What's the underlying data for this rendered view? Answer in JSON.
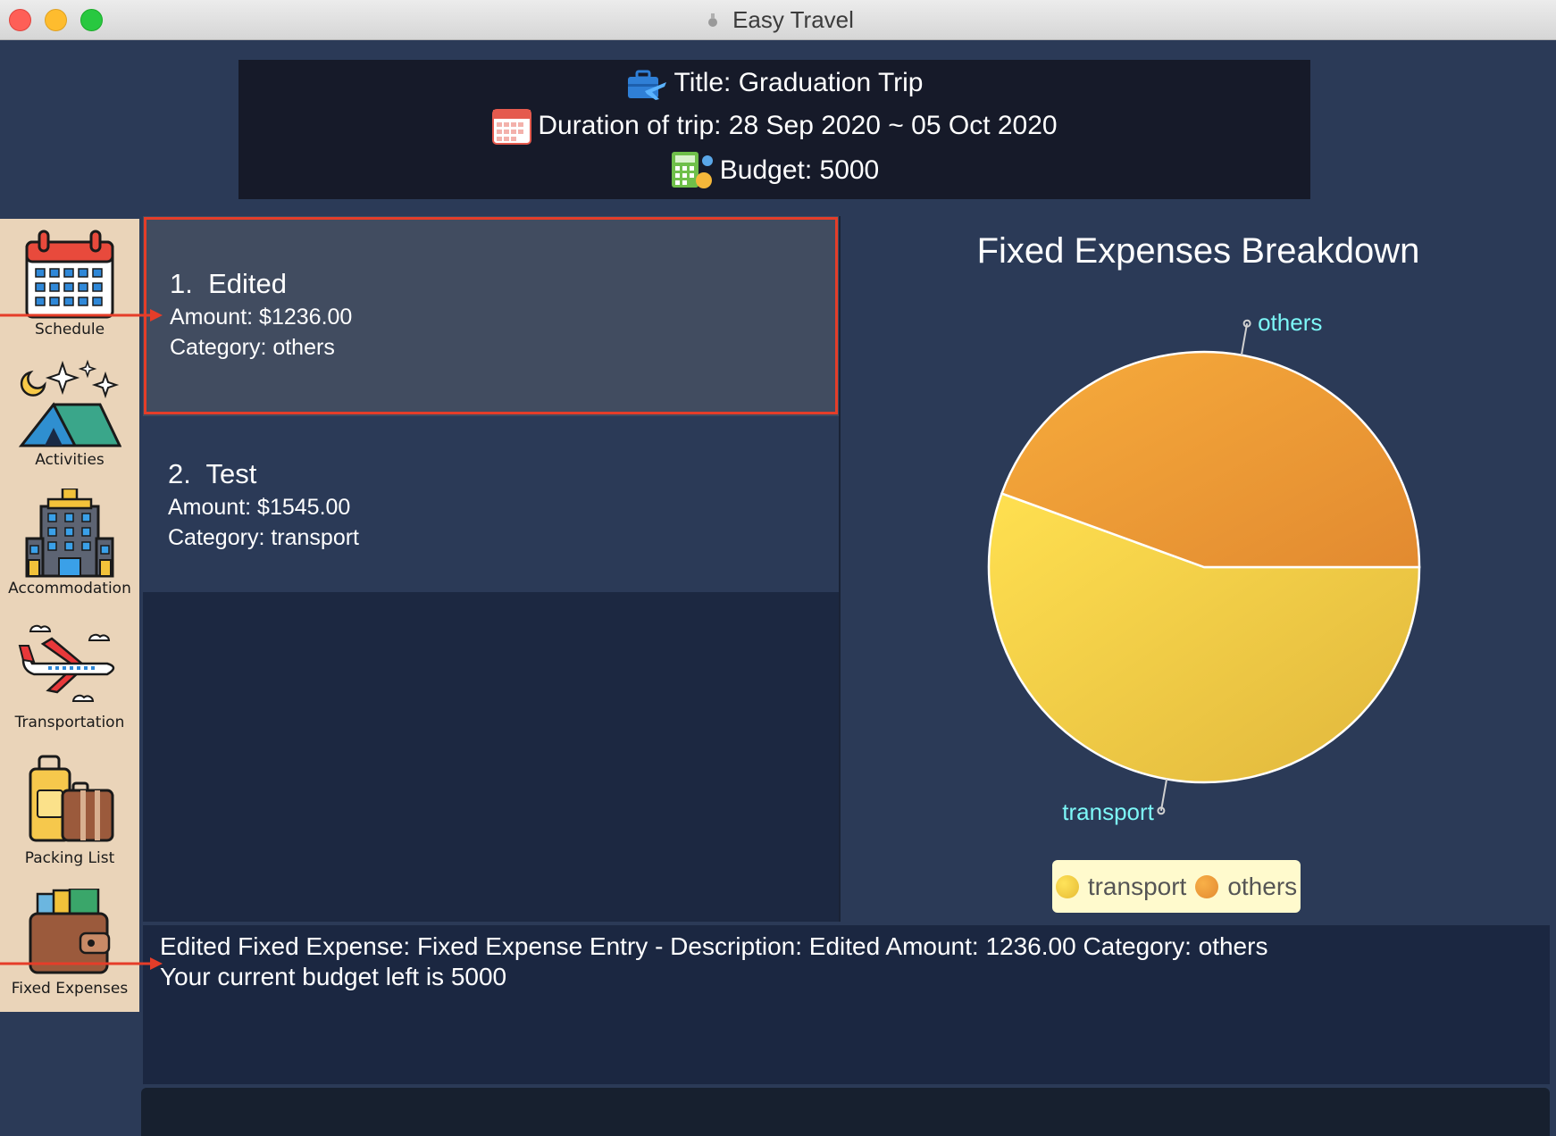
{
  "window": {
    "title": "Easy Travel"
  },
  "trip": {
    "title_text": "Title: Graduation Trip",
    "duration_text": "Duration of trip: 28 Sep 2020 ~ 05 Oct 2020",
    "budget_text": "Budget: 5000"
  },
  "sidebar": {
    "items": [
      {
        "label": "Schedule",
        "icon": "calendar-icon"
      },
      {
        "label": "Activities",
        "icon": "tent-icon"
      },
      {
        "label": "Accommodation",
        "icon": "hotel-icon"
      },
      {
        "label": "Transportation",
        "icon": "airplane-icon"
      },
      {
        "label": "Packing List",
        "icon": "luggage-icon"
      },
      {
        "label": "Fixed Expenses",
        "icon": "wallet-icon"
      }
    ]
  },
  "expenses": [
    {
      "index": "1.",
      "description": "Edited",
      "amount_text": "Amount: $1236.00",
      "category_text": "Category: others"
    },
    {
      "index": "2.",
      "description": "Test",
      "amount_text": "Amount: $1545.00",
      "category_text": "Category: transport"
    }
  ],
  "chart_data": {
    "type": "pie",
    "title": "Fixed Expenses Breakdown",
    "categories": [
      "transport",
      "others"
    ],
    "values": [
      1545.0,
      1236.0
    ],
    "colors": [
      "#f2c634",
      "#f29a35"
    ],
    "labels_color": "#7df8f8",
    "legend": {
      "position": "bottom",
      "entries": [
        "transport",
        "others"
      ]
    }
  },
  "result": {
    "lines": [
      "Edited Fixed Expense: Fixed Expense Entry - Description: Edited Amount: 1236.00 Category: others",
      "Your current budget left is 5000"
    ]
  },
  "command_box": {
    "value": ""
  },
  "colors": {
    "highlight": "#e53d29",
    "background": "#2b3a57",
    "header": "#161a29",
    "sidebar": "#ead4b9"
  }
}
